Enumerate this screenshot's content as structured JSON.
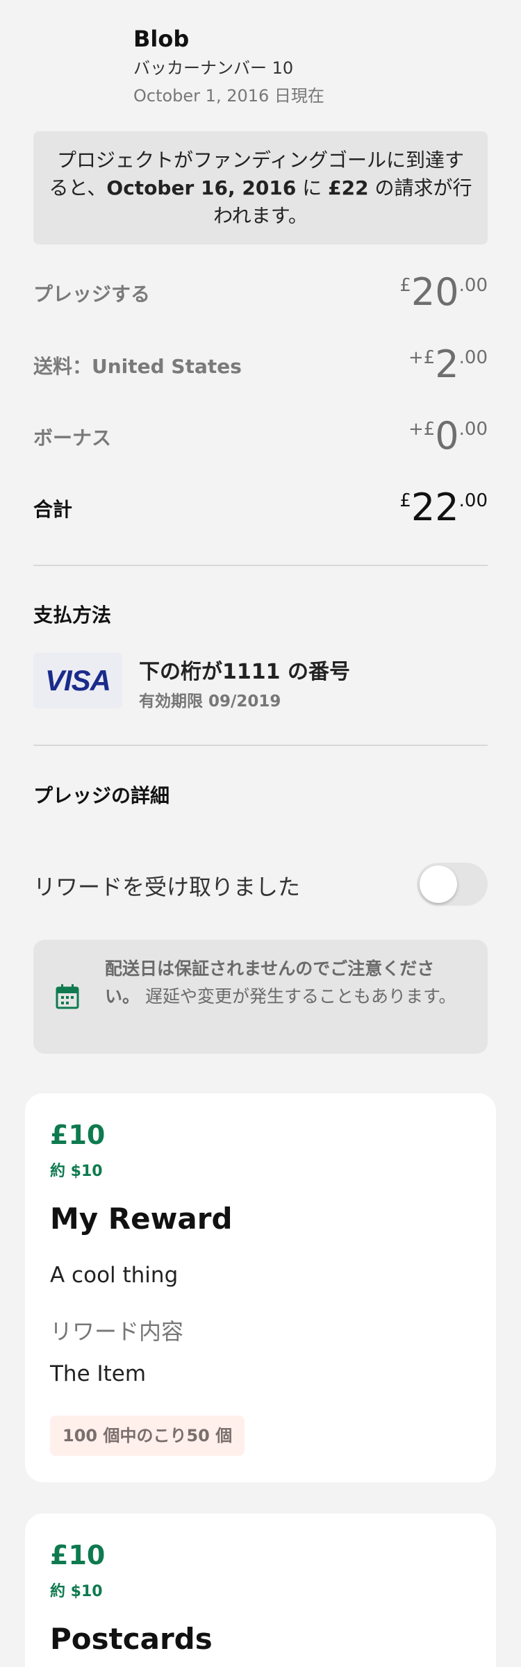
{
  "header": {
    "backer_name": "Blob",
    "backer_number": "バッカーナンバー 10",
    "as_of": "October 1, 2016 日現在"
  },
  "charge_notice": {
    "part1": "プロジェクトがファンディングゴールに到達すると、",
    "date": "October 16, 2016",
    "part2": " に ",
    "amount": "£22",
    "part3": " の請求が行われます。"
  },
  "summary": {
    "pledge": {
      "label": "プレッジする",
      "prefix": "£",
      "main": "20",
      "cents": ".00"
    },
    "shipping": {
      "label": "送料：United States",
      "prefix": "+£",
      "main": "2",
      "cents": ".00"
    },
    "bonus": {
      "label": "ボーナス",
      "prefix": "+£",
      "main": "0",
      "cents": ".00"
    },
    "total": {
      "label": "合計",
      "prefix": "£",
      "main": "22",
      "cents": ".00"
    }
  },
  "payment": {
    "title": "支払方法",
    "card_brand": "VISA",
    "card_label": "下の桁が1111 の番号",
    "expiry": "有効期限 09/2019"
  },
  "pledge_details": {
    "title": "プレッジの詳細",
    "reward_received_label": "リワードを受け取りました",
    "reward_received": false
  },
  "delivery_notice": {
    "bold": "配送日は保証されませんのでご注意ください。",
    "rest": " 遅延や変更が発生することもあります。",
    "icon": "calendar-icon"
  },
  "rewards": [
    {
      "price": "£10",
      "approx": "約 $10",
      "title": "My Reward",
      "description": "A cool thing",
      "items_header": "リワード内容",
      "item": "The Item",
      "remaining": "100 個中のこり50 個"
    },
    {
      "price": "£10",
      "approx": "約 $10",
      "title": "Postcards"
    }
  ],
  "colors": {
    "accent_green": "#0f7a4f",
    "background": "#f3f3f3",
    "card": "#ffffff",
    "visa_blue": "#1a2b8a"
  }
}
